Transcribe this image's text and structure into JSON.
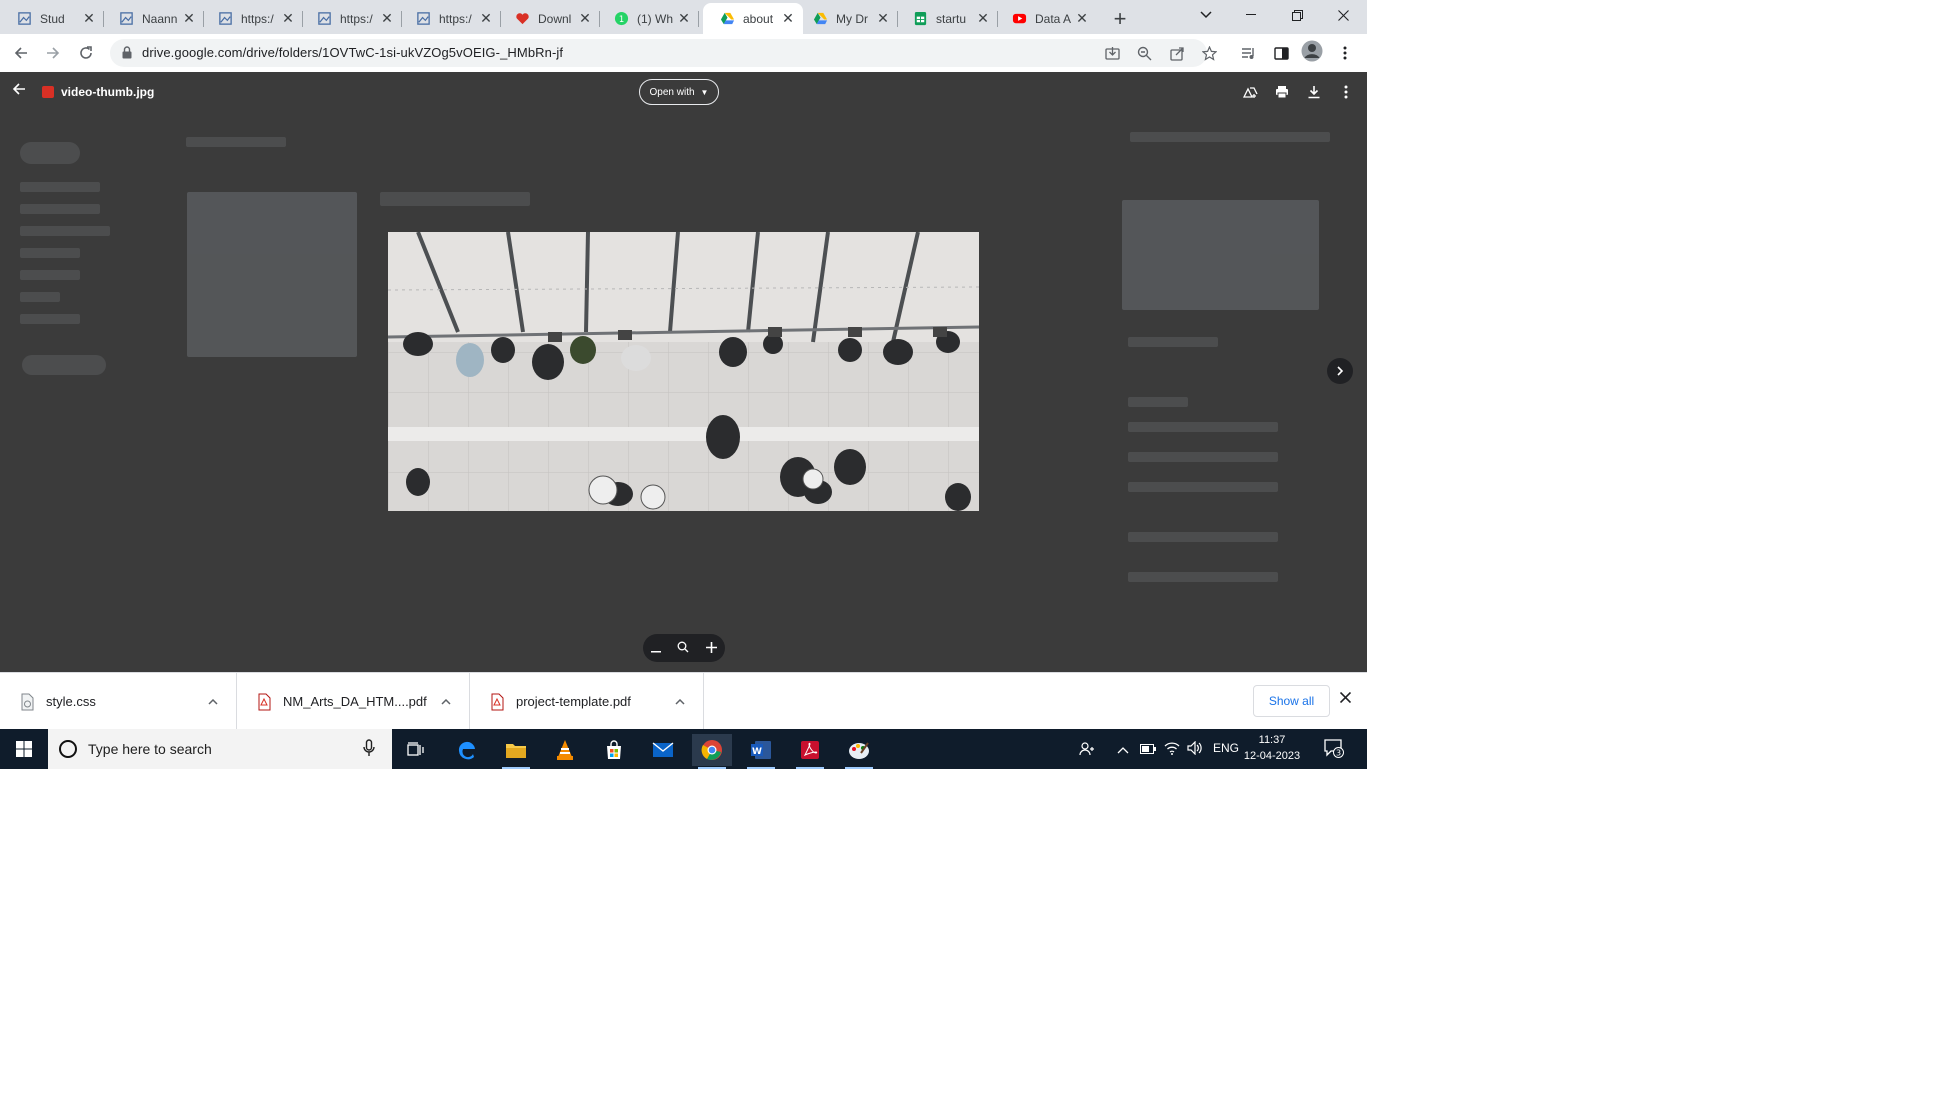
{
  "browser": {
    "tabs": [
      {
        "title": "Stud",
        "icon": "image-doc-icon",
        "color": "#4a6fa5"
      },
      {
        "title": "Naann",
        "icon": "image-doc-icon",
        "color": "#4a6fa5"
      },
      {
        "title": "https:/",
        "icon": "image-doc-icon",
        "color": "#4a6fa5"
      },
      {
        "title": "https:/",
        "icon": "image-doc-icon",
        "color": "#4a6fa5"
      },
      {
        "title": "https:/",
        "icon": "image-doc-icon",
        "color": "#4a6fa5"
      },
      {
        "title": "Downl",
        "icon": "heart-icon",
        "color": "#d93025"
      },
      {
        "title": "(1) Wh",
        "icon": "whatsapp-icon",
        "color": "#25d366"
      },
      {
        "title": "about",
        "icon": "google-drive-icon",
        "color": "#1a73e8",
        "active": true
      },
      {
        "title": "My Dr",
        "icon": "google-drive-icon",
        "color": "#1a73e8"
      },
      {
        "title": "startu",
        "icon": "google-sheets-icon",
        "color": "#0f9d58"
      },
      {
        "title": "Data A",
        "icon": "youtube-icon",
        "color": "#ff0000"
      }
    ],
    "url": "drive.google.com/drive/folders/1OVTwC-1si-ukVZOg5vOEIG-_HMbRn-jf"
  },
  "viewer": {
    "file_name": "video-thumb.jpg",
    "open_with_label": "Open with"
  },
  "downloads": {
    "items": [
      {
        "name": "style.css",
        "icon": "css-file-icon"
      },
      {
        "name": "NM_Arts_DA_HTM....pdf",
        "icon": "pdf-file-icon"
      },
      {
        "name": "project-template.pdf",
        "icon": "pdf-file-icon"
      }
    ],
    "show_all_label": "Show all"
  },
  "taskbar": {
    "search_placeholder": "Type here to search",
    "language": "ENG",
    "time": "11:37",
    "date": "12-04-2023",
    "notification_count": "3"
  },
  "colors": {
    "viewer_bg": "#3b3b3b",
    "tabstrip_bg": "#dee1e6",
    "taskbar_bg": "#0f1c2b",
    "accent": "#1a73e8"
  }
}
